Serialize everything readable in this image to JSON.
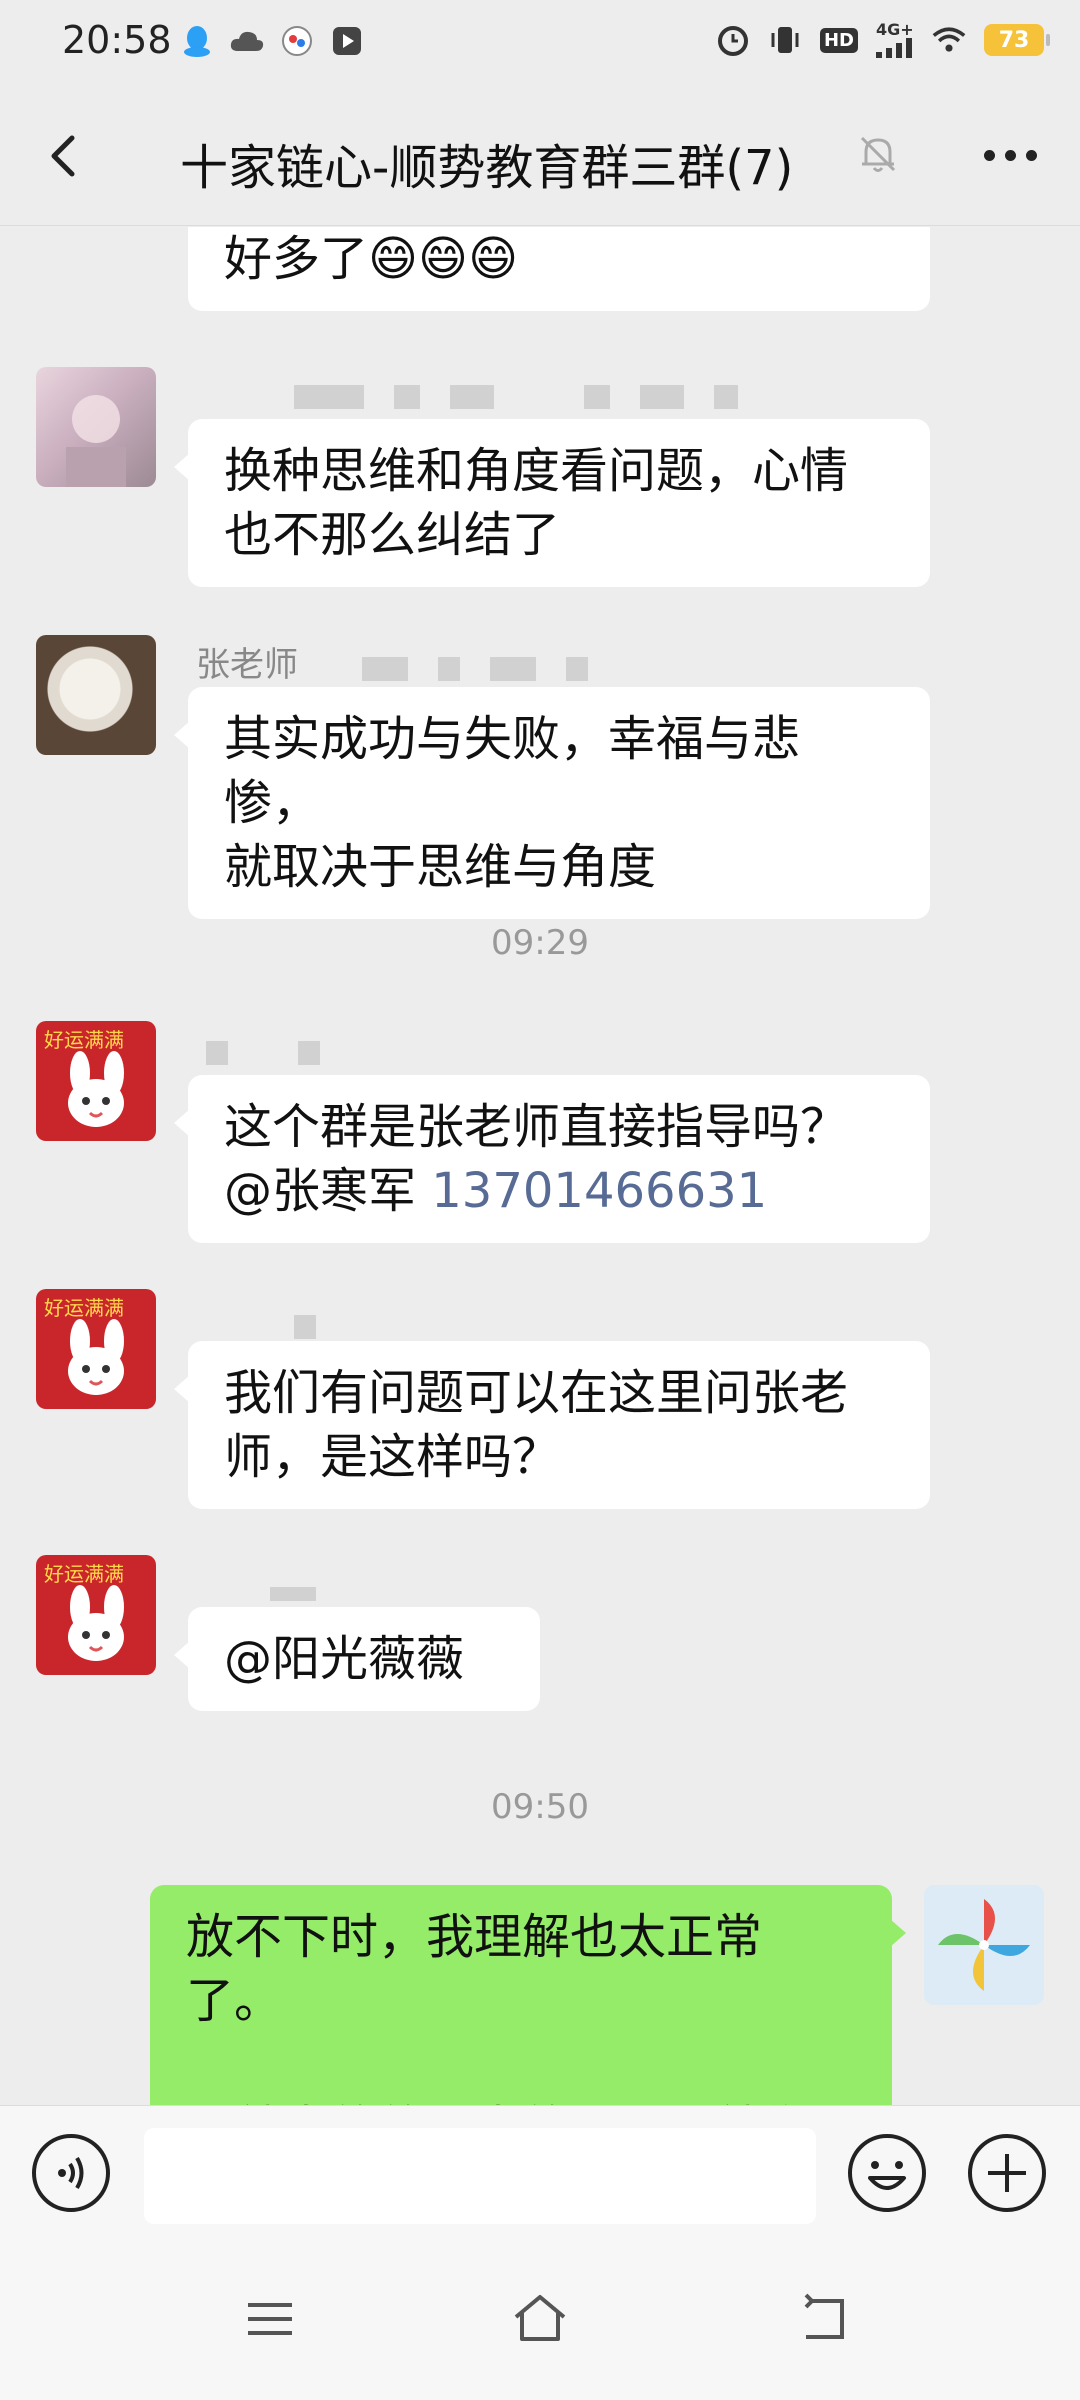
{
  "status_bar": {
    "time": "20:58",
    "network": "4G+",
    "hd": "HD",
    "battery": "73",
    "icons": [
      "qq-icon",
      "cloud-icon",
      "app-icon",
      "play-icon",
      "alarm-icon",
      "vibrate-icon",
      "hd-icon",
      "signal-icon",
      "wifi-icon",
      "battery-icon"
    ]
  },
  "header": {
    "title": "十家链心-顺势教育群三群(7)",
    "back_icon": "chevron-left-icon",
    "mute_icon": "bell-off-icon",
    "more_icon": "more-dots-icon"
  },
  "messages": [
    {
      "sender": "",
      "text": "好多了😄😄😄",
      "side": "left",
      "partial": true
    },
    {
      "sender": "",
      "text_lines": [
        "换种思维和角度看问题，心情",
        "也不那么纠结了"
      ],
      "side": "left"
    },
    {
      "sender": "张老师",
      "text_lines": [
        "其实成功与失败，幸福与悲惨，",
        "就取决于思维与角度"
      ],
      "side": "left"
    },
    {
      "timestamp": "09:29"
    },
    {
      "sender": "",
      "text_lines": [
        "这个群是张老师直接指导吗？"
      ],
      "mention": "@张寒军 ",
      "phone": "13701466631",
      "side": "left"
    },
    {
      "sender": "",
      "text_lines": [
        "我们有问题可以在这里问张老",
        "师，是这样吗？"
      ],
      "side": "left"
    },
    {
      "sender": "",
      "text": "@阳光薇薇",
      "side": "left"
    },
    {
      "timestamp": "09:50"
    },
    {
      "sender": "me",
      "text_lines": [
        "放不下时，我理解也太正常了。",
        "",
        "那就先放放，先放一下，就像"
      ],
      "side": "right"
    }
  ],
  "input_bar": {
    "value": "",
    "voice_icon": "voice-icon",
    "emoji_icon": "emoji-icon",
    "plus_icon": "plus-icon"
  },
  "nav_bar": {
    "icons": [
      "menu-icon",
      "home-icon",
      "back-icon"
    ]
  },
  "colors": {
    "background": "#ededed",
    "bubble_in": "#ffffff",
    "bubble_out": "#95ec69",
    "link": "#576b95",
    "battery": "#f5c23a"
  }
}
